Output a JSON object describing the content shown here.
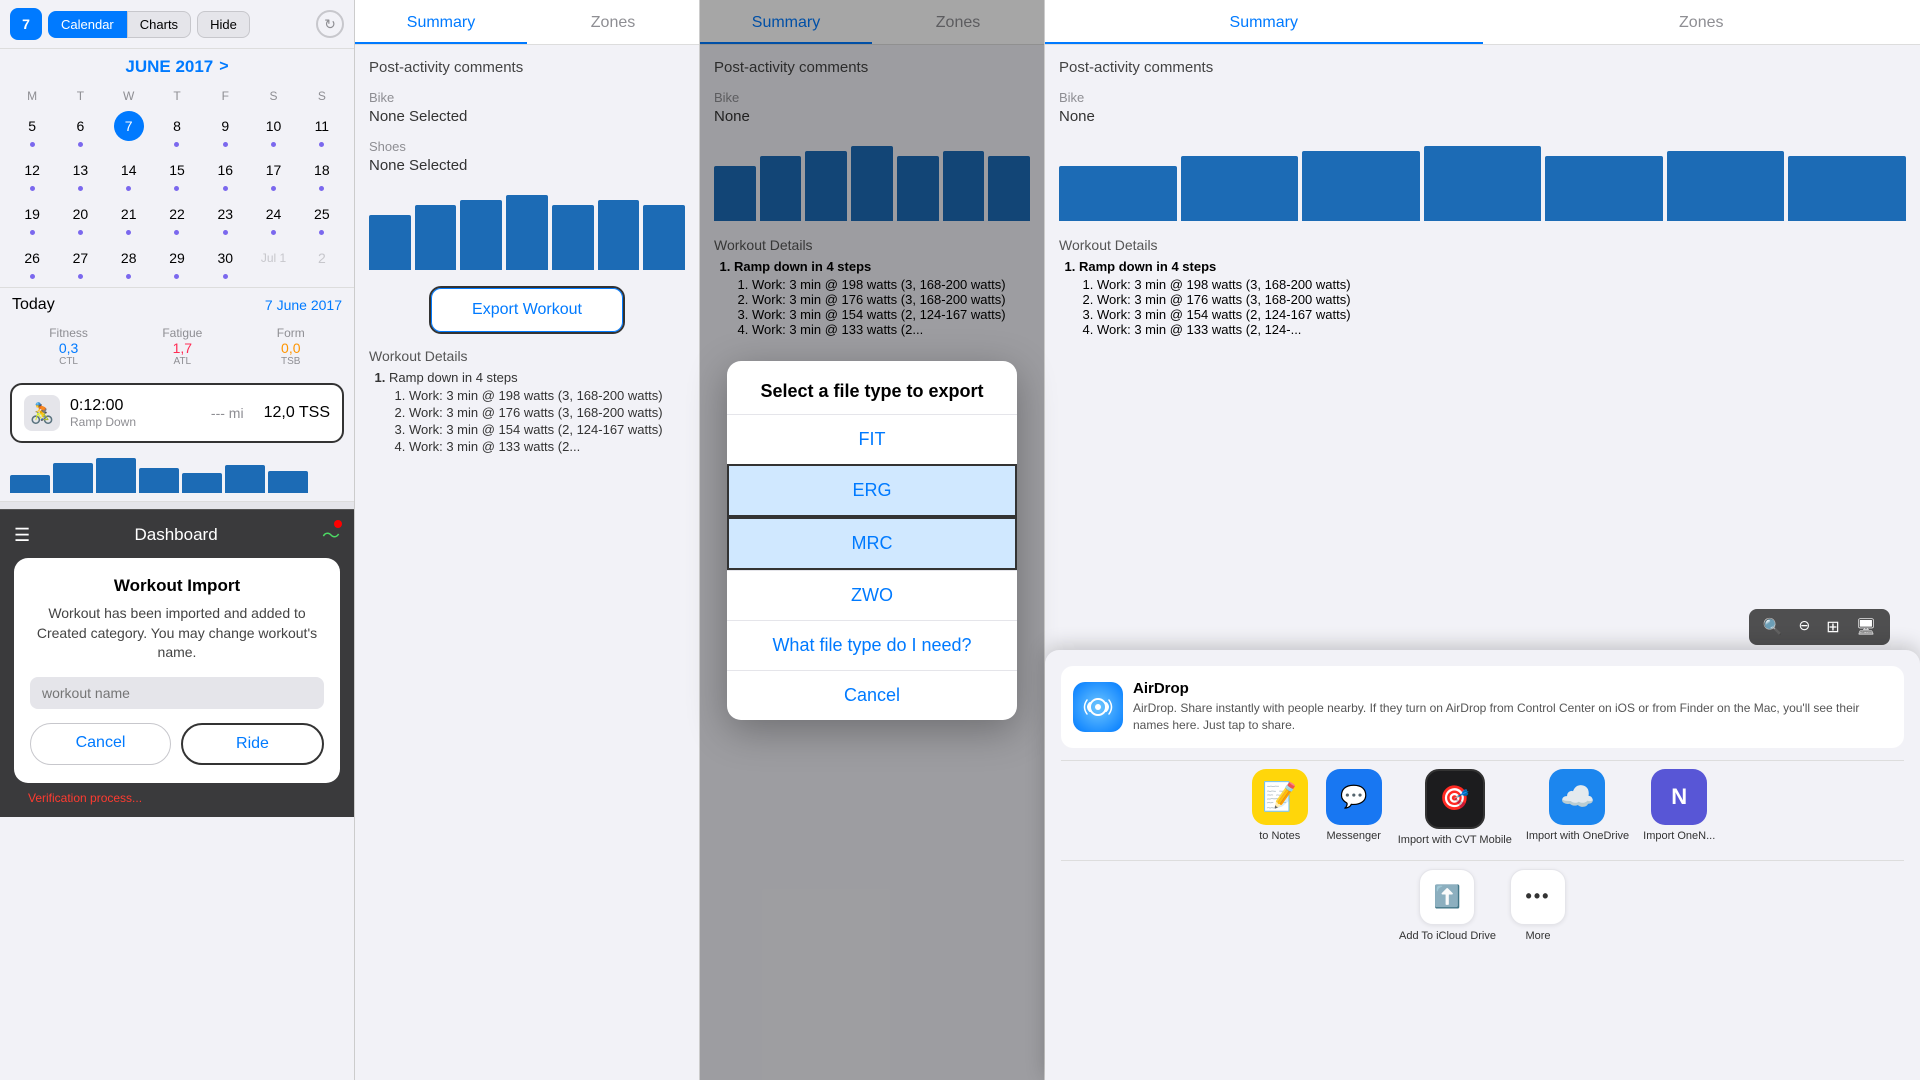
{
  "calendar": {
    "date_badge": "7",
    "tab_calendar": "Calendar",
    "tab_charts": "Charts",
    "btn_hide": "Hide",
    "month_title": "JUNE 2017",
    "arrow": ">",
    "weekdays": [
      "M",
      "T",
      "W",
      "T",
      "F",
      "S",
      "S"
    ],
    "weeks": [
      [
        {
          "num": "5",
          "dot": true,
          "today": false,
          "other": false
        },
        {
          "num": "6",
          "dot": true,
          "today": false,
          "other": false
        },
        {
          "num": "7",
          "dot": false,
          "today": true,
          "other": false
        },
        {
          "num": "8",
          "dot": true,
          "today": false,
          "other": false
        },
        {
          "num": "9",
          "dot": true,
          "today": false,
          "other": false
        },
        {
          "num": "10",
          "dot": true,
          "today": false,
          "other": false
        },
        {
          "num": "11",
          "dot": true,
          "today": false,
          "other": false
        }
      ],
      [
        {
          "num": "12",
          "dot": true,
          "today": false,
          "other": false
        },
        {
          "num": "13",
          "dot": true,
          "today": false,
          "other": false
        },
        {
          "num": "14",
          "dot": true,
          "today": false,
          "other": false
        },
        {
          "num": "15",
          "dot": true,
          "today": false,
          "other": false
        },
        {
          "num": "16",
          "dot": true,
          "today": false,
          "other": false
        },
        {
          "num": "17",
          "dot": true,
          "today": false,
          "other": false
        },
        {
          "num": "18",
          "dot": true,
          "today": false,
          "other": false
        }
      ],
      [
        {
          "num": "19",
          "dot": true,
          "today": false,
          "other": false
        },
        {
          "num": "20",
          "dot": true,
          "today": false,
          "other": false
        },
        {
          "num": "21",
          "dot": true,
          "today": false,
          "other": false
        },
        {
          "num": "22",
          "dot": true,
          "today": false,
          "other": false
        },
        {
          "num": "23",
          "dot": true,
          "today": false,
          "other": false
        },
        {
          "num": "24",
          "dot": true,
          "today": false,
          "other": false
        },
        {
          "num": "25",
          "dot": true,
          "today": false,
          "other": false
        }
      ],
      [
        {
          "num": "26",
          "dot": true,
          "today": false,
          "other": false
        },
        {
          "num": "27",
          "dot": true,
          "today": false,
          "other": false
        },
        {
          "num": "28",
          "dot": true,
          "today": false,
          "other": false
        },
        {
          "num": "29",
          "dot": true,
          "today": false,
          "other": false
        },
        {
          "num": "30",
          "dot": true,
          "today": false,
          "other": false
        },
        {
          "num": "Jul 1",
          "dot": false,
          "today": false,
          "other": true
        },
        {
          "num": "2",
          "dot": false,
          "today": false,
          "other": true
        }
      ]
    ],
    "today_label": "Today",
    "today_date": "7 June 2017",
    "fitness_label": "Fitness",
    "fitness_value": "0,3",
    "fitness_unit": "CTL",
    "fatigue_label": "Fatigue",
    "fatigue_value": "1,7",
    "fatigue_unit": "ATL",
    "form_label": "Form",
    "form_value": "0,0",
    "form_unit": "TSB",
    "workout_time": "0:12:00",
    "workout_mi": "--- mi",
    "workout_tss": "12,0 TSS",
    "workout_name": "Ramp Down"
  },
  "dashboard": {
    "title": "Dashboard",
    "import_title": "Workout Import",
    "import_text": "Workout has been imported and added to Created category. You may change workout's name.",
    "input_placeholder": "workout name",
    "cancel_label": "Cancel",
    "ride_label": "Ride",
    "verification_text": "Verification process..."
  },
  "summary_panel2": {
    "tab_summary": "Summary",
    "tab_zones": "Zones",
    "post_activity": "Post-activity comments",
    "bike_label": "Bike",
    "bike_value": "None Selected",
    "shoes_label": "Shoes",
    "shoes_value": "None Selected",
    "export_btn": "Export Workout",
    "workout_details": "Workout Details",
    "step_title": "Ramp down in 4 steps",
    "steps": [
      "Work: 3 min @ 198 watts (3, 168-200 watts)",
      "Work: 3 min @ 176 watts (3, 168-200 watts)",
      "Work: 3 min @ 154 watts (2, 124-167 watts)",
      "Work: 3 min @ 133 watts (2..."
    ]
  },
  "export_dialog": {
    "title": "Select a file type to export",
    "options": [
      "FIT",
      "ERG",
      "MRC",
      "ZWO"
    ],
    "help": "What file type do I need?",
    "cancel": "Cancel",
    "selected": "ERG"
  },
  "summary_panel3": {
    "tab_summary": "Summary",
    "tab_zones": "Zones",
    "post_activity": "Post-activity comments",
    "bike_label": "Bike",
    "bike_value": "None"
  },
  "summary_panel4": {
    "tab_summary": "Summary",
    "tab_zones": "Zones",
    "post_activity": "Post-activity comments",
    "bike_label": "Bike",
    "bike_value": "None"
  },
  "share_sheet": {
    "airdrop_title": "AirDrop",
    "airdrop_desc": "AirDrop. Share instantly with people nearby. If they turn on AirDrop from Control Center on iOS or from Finder on the Mac, you'll see their names here. Just tap to share.",
    "apps": [
      {
        "label": "to Notes",
        "icon": "📝",
        "color": "#ffd60a"
      },
      {
        "label": "Messenger",
        "icon": "💬",
        "color": "#1877f2"
      },
      {
        "label": "Import with CVT Mobile",
        "icon": "🎯",
        "color": "#1c1c1e"
      },
      {
        "label": "Import with OneDrive",
        "icon": "☁️",
        "color": "#1c86ee"
      },
      {
        "label": "Import OneN...",
        "icon": "N",
        "color": "#5856d6"
      }
    ],
    "actions": [
      {
        "label": "Add To iCloud Drive",
        "icon": "⬆️"
      },
      {
        "label": "More",
        "icon": "•••"
      }
    ]
  },
  "zoom_toolbar": {
    "btns": [
      "🔍+",
      "🔍-",
      "⊞",
      "🖥"
    ]
  },
  "bar_heights_main": [
    55,
    65,
    70,
    75,
    65,
    70,
    65
  ],
  "bar_heights_small": [
    18,
    25,
    28,
    22,
    20
  ]
}
